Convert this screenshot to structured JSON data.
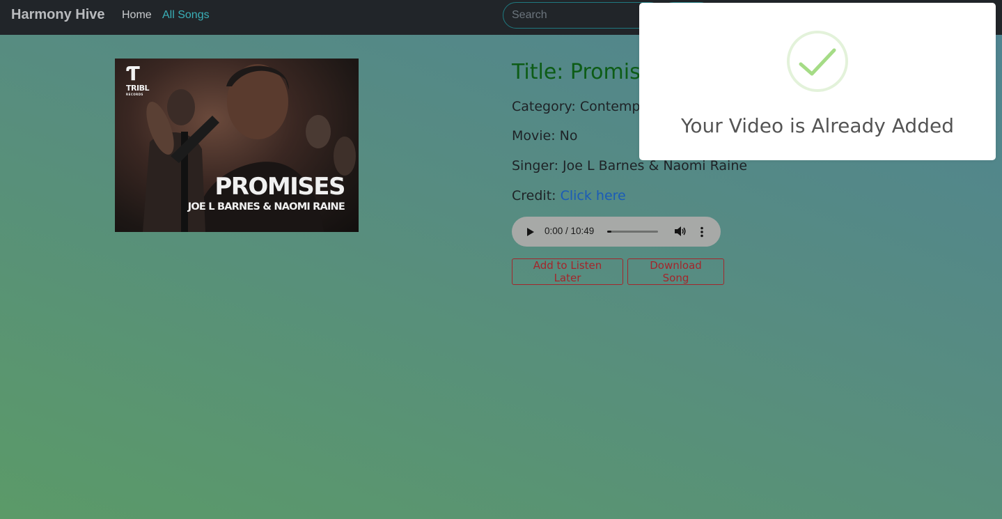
{
  "navbar": {
    "brand": "Harmony Hive",
    "links": [
      {
        "label": "Home"
      },
      {
        "label": "All Songs"
      }
    ],
    "search": {
      "placeholder": "Search",
      "value": ""
    }
  },
  "song": {
    "thumbnail": {
      "logo_text": "TRIBL",
      "logo_subtext": "RECORDS",
      "overlay_title": "PROMISES",
      "overlay_subtitle": "JOE L BARNES & NAOMI RAINE"
    },
    "title": "Title: Promise",
    "category": "Category: Contempo",
    "movie": "Movie: No",
    "singer": "Singer: Joe L Barnes & Naomi Raine",
    "credit_label": "Credit: ",
    "credit_link": "Click here",
    "audio": {
      "time": "0:00 / 10:49",
      "progress": 0
    },
    "buttons": {
      "listen_later": "Add to Listen Later",
      "download": "Download Song"
    }
  },
  "modal": {
    "title": "Your Video is Already Added",
    "icon": "success-check-icon",
    "icon_color": "#a5dc86"
  },
  "colors": {
    "navbar_bg": "#212529",
    "active_link": "#3ab0b8",
    "song_title": "#0d5c16",
    "button_outline": "#a3262b",
    "link": "#1a5bb8"
  }
}
